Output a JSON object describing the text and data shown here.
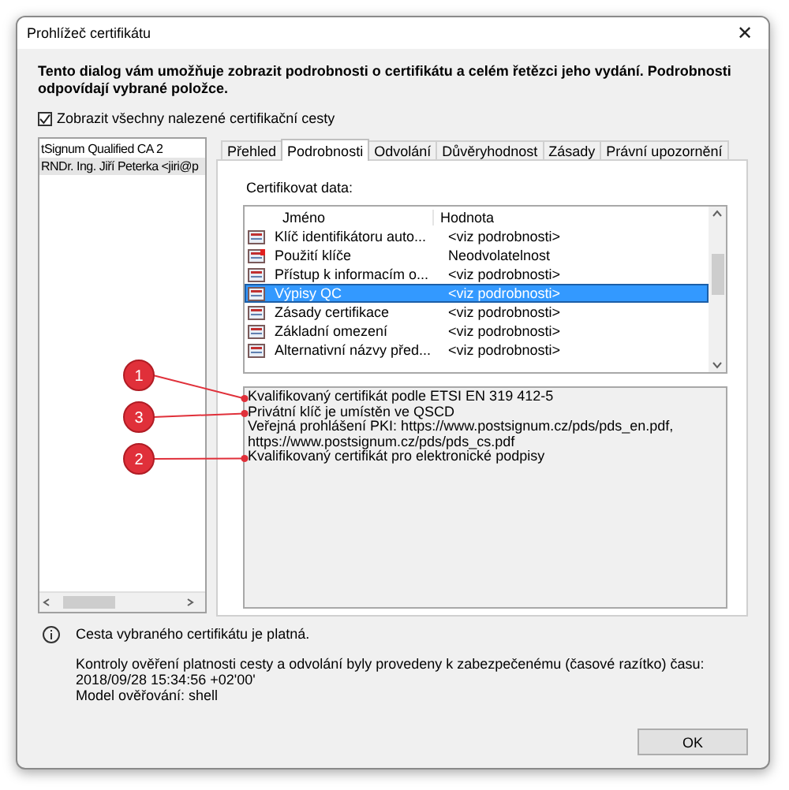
{
  "window": {
    "title": "Prohlížeč certifikátu",
    "close": "✕"
  },
  "intro": "Tento dialog vám umožňuje zobrazit podrobnosti o certifikátu a celém řetězci jeho vydání. Podrobnosti odpovídají vybrané položce.",
  "show_all_paths": {
    "label": "Zobrazit všechny nalezené certifikační cesty",
    "checked": true
  },
  "tree": {
    "items": [
      {
        "label": "tSignum Qualified CA 2",
        "selected": false
      },
      {
        "label": "RNDr. Ing. Jiří Peterka <jiri@p",
        "selected": true
      }
    ]
  },
  "tabs": [
    {
      "label": "Přehled",
      "selected": false
    },
    {
      "label": "Podrobnosti",
      "selected": true
    },
    {
      "label": "Odvolání",
      "selected": false
    },
    {
      "label": "Důvěryhodnost",
      "selected": false
    },
    {
      "label": "Zásady",
      "selected": false
    },
    {
      "label": "Právní upozornění",
      "selected": false
    }
  ],
  "details": {
    "label": "Certifikovat data:",
    "columns": [
      "Jméno",
      "Hodnota"
    ],
    "rows": [
      {
        "kind": "plain",
        "name": "Klíč identifikátoru auto...",
        "value": "<viz podrobnosti>",
        "selected": false
      },
      {
        "kind": "flagged",
        "name": "Použití klíče",
        "value": "Neodvolatelnost",
        "selected": false
      },
      {
        "kind": "plain",
        "name": "Přístup k informacím o...",
        "value": "<viz podrobnosti>",
        "selected": false
      },
      {
        "kind": "plain",
        "name": "Výpisy QC",
        "value": "<viz podrobnosti>",
        "selected": true
      },
      {
        "kind": "plain",
        "name": "Zásady certifikace",
        "value": "<viz podrobnosti>",
        "selected": false
      },
      {
        "kind": "plain",
        "name": "Základní omezení",
        "value": "<viz podrobnosti>",
        "selected": false
      },
      {
        "kind": "plain",
        "name": "Alternativní názvy před...",
        "value": "<viz podrobnosti>",
        "selected": false
      }
    ],
    "value_lines": [
      {
        "text": "Kvalifikovaný certifikát podle ETSI EN 319 412-5",
        "callout": "1"
      },
      {
        "text": "Privátní klíč je umístěn ve QSCD",
        "callout": "3"
      },
      {
        "text": "Veřejná prohlášení PKI: https://www.postsignum.cz/pds/pds_en.pdf,"
      },
      {
        "text": "https://www.postsignum.cz/pds/pds_cs.pdf"
      },
      {
        "text": "Kvalifikovaný certifikát pro elektronické podpisy",
        "callout": "2"
      }
    ]
  },
  "status": {
    "message": "Cesta vybraného certifikátu je platná.",
    "lines": [
      "Kontroly ověření platnosti cesty a odvolání byly provedeny k zabezpečenému (časové razítko) času:",
      "2018/09/28 15:34:56 +02'00'",
      "Model ověřování: shell"
    ]
  },
  "buttons": [
    "OK"
  ]
}
